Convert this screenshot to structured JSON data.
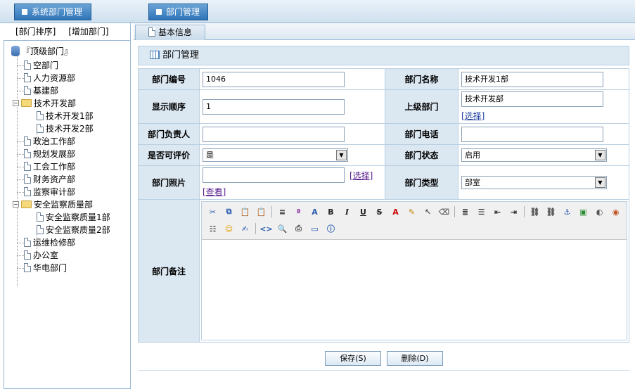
{
  "top_tabs": [
    "系统部门管理",
    "部门管理"
  ],
  "left_actions": [
    "[部门排序]",
    "[增加部门]"
  ],
  "tree": {
    "root": "『顶级部门』",
    "items": [
      "空部门",
      "人力资源部",
      "基建部",
      "技术开发部",
      "技术开发1部",
      "技术开发2部",
      "政治工作部",
      "规划发展部",
      "工会工作部",
      "财务资产部",
      "监察审计部",
      "安全监察质量部",
      "安全监察质量1部",
      "安全监察质量2部",
      "运维检修部",
      "办公室",
      "华电部门"
    ]
  },
  "subtab": "基本信息",
  "panel_title": "部门管理",
  "form": {
    "labels": {
      "dept_no": "部门编号",
      "dept_name": "部门名称",
      "order": "显示顺序",
      "parent": "上级部门",
      "head": "部门负责人",
      "phone": "部门电话",
      "evaluable": "是否可评价",
      "status": "部门状态",
      "photo": "部门照片",
      "type": "部门类型",
      "remark": "部门备注"
    },
    "values": {
      "dept_no": "1046",
      "dept_name": "技术开发1部",
      "order": "1",
      "parent": "技术开发部",
      "head": "",
      "phone": "",
      "evaluable": "是",
      "status": "启用",
      "photo": "",
      "type": "部室"
    },
    "select_link": "[选择]",
    "view_link": "[查看]"
  },
  "buttons": {
    "save": "保存(S)",
    "delete": "删除(D)"
  },
  "colors": {
    "tab_blue": "#2f75b8",
    "label_bg": "#dbe7f1",
    "border": "#b9cfe1"
  }
}
